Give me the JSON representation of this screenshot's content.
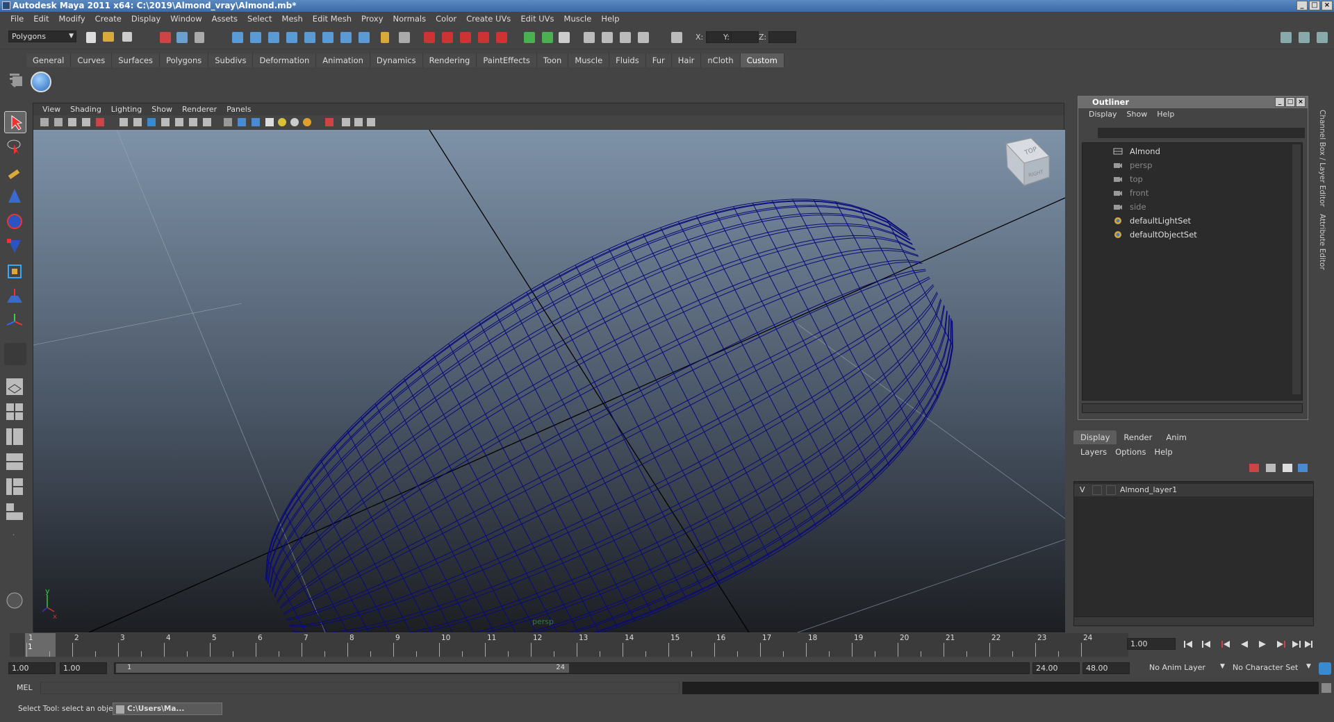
{
  "window": {
    "title": "Autodesk Maya 2011 x64: C:\\2019\\Almond_vray\\Almond.mb*"
  },
  "menus": [
    "File",
    "Edit",
    "Modify",
    "Create",
    "Display",
    "Window",
    "Assets",
    "Select",
    "Mesh",
    "Edit Mesh",
    "Proxy",
    "Normals",
    "Color",
    "Create UVs",
    "Edit UVs",
    "Muscle",
    "Help"
  ],
  "toolbar": {
    "mode": "Polygons",
    "x_label": "X:",
    "y_label": "Y:",
    "z_label": "Z:"
  },
  "shelf_tabs": [
    "General",
    "Curves",
    "Surfaces",
    "Polygons",
    "Subdivs",
    "Deformation",
    "Animation",
    "Dynamics",
    "Rendering",
    "PaintEffects",
    "Toon",
    "Muscle",
    "Fluids",
    "Fur",
    "Hair",
    "nCloth",
    "Custom"
  ],
  "shelf_active": "Custom",
  "viewport": {
    "menu": [
      "View",
      "Shading",
      "Lighting",
      "Show",
      "Renderer",
      "Panels"
    ],
    "camera_label": "persp",
    "viewcube_top": "TOP",
    "viewcube_side": "RIGHT",
    "axis_y": "y",
    "axis_x": "x"
  },
  "outliner": {
    "title": "Outliner",
    "menu": [
      "Display",
      "Show",
      "Help"
    ],
    "items": [
      {
        "label": "Almond",
        "dim": false,
        "icon": "mesh-icon"
      },
      {
        "label": "persp",
        "dim": true,
        "icon": "camera-icon"
      },
      {
        "label": "top",
        "dim": true,
        "icon": "camera-icon"
      },
      {
        "label": "front",
        "dim": true,
        "icon": "camera-icon"
      },
      {
        "label": "side",
        "dim": true,
        "icon": "camera-icon"
      },
      {
        "label": "defaultLightSet",
        "dim": false,
        "icon": "set-icon"
      },
      {
        "label": "defaultObjectSet",
        "dim": false,
        "icon": "set-icon"
      }
    ]
  },
  "side_tabs": [
    "Channel Box / Layer Editor",
    "Attribute Editor"
  ],
  "layer_editor": {
    "tabs": [
      "Display",
      "Render",
      "Anim"
    ],
    "active_tab": "Display",
    "menu": [
      "Layers",
      "Options",
      "Help"
    ],
    "layers": [
      {
        "visible": "V",
        "name": "Almond_layer1"
      }
    ]
  },
  "timeline": {
    "ticks": [
      "1",
      "2",
      "3",
      "4",
      "5",
      "6",
      "7",
      "8",
      "9",
      "10",
      "11",
      "12",
      "13",
      "14",
      "15",
      "16",
      "17",
      "18",
      "19",
      "20",
      "21",
      "22",
      "23",
      "24"
    ],
    "current_frame_marker": "1",
    "current_time": "1.00"
  },
  "range": {
    "start": "1.00",
    "playback_start": "1.00",
    "slider_start": "1",
    "slider_end": "24",
    "playback_end": "24.00",
    "end": "48.00",
    "anim_layer": "No Anim Layer",
    "character_set": "No Character Set"
  },
  "command_line": {
    "label": "MEL"
  },
  "help_line": {
    "text": "Select Tool: select an object",
    "task_item": "C:\\Users\\Ma..."
  },
  "colors": {
    "wireframe": "#0a0a7a",
    "bg_top": "#7e92a8",
    "bg_bottom": "#1c1e22"
  }
}
